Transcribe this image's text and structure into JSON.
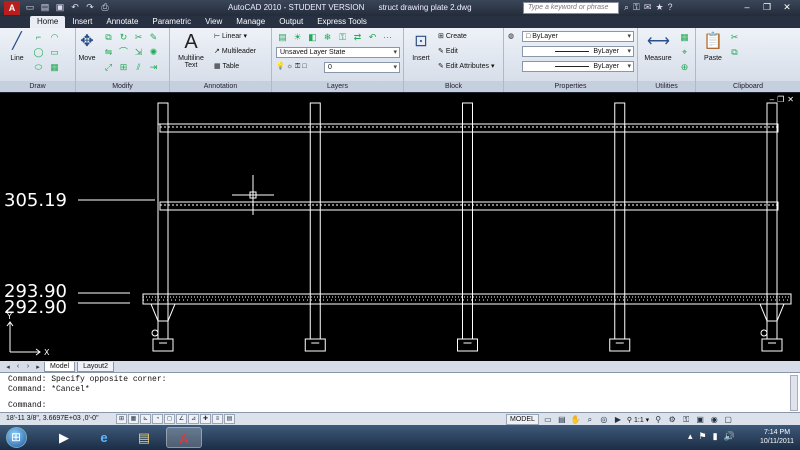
{
  "titlebar": {
    "app_name": "AutoCAD 2010 - STUDENT VERSION",
    "file_name": "struct drawing plate 2.dwg",
    "search_placeholder": "Type a keyword or phrase"
  },
  "ribbon_tabs": [
    "Home",
    "Insert",
    "Annotate",
    "Parametric",
    "View",
    "Manage",
    "Output",
    "Express Tools"
  ],
  "active_tab": "Home",
  "panels": {
    "draw": {
      "title": "Draw",
      "line_label": "Line"
    },
    "modify": {
      "title": "Modify",
      "move_label": "Move"
    },
    "annotation": {
      "title": "Annotation",
      "multiline_label_1": "Multiline",
      "multiline_label_2": "Text",
      "linear_label": "Linear",
      "multileader_label": "Multileader",
      "table_label": "Table"
    },
    "layers": {
      "title": "Layers",
      "layer_state": "Unsaved Layer State",
      "current_layer": "0"
    },
    "block": {
      "title": "Block",
      "insert_label": "Insert",
      "create_label": "Create",
      "edit_label": "Edit",
      "edit_attributes_label": "Edit Attributes"
    },
    "properties": {
      "title": "Properties",
      "color": "ByLayer",
      "linetype": "ByLayer",
      "lineweight": "ByLayer"
    },
    "utilities": {
      "title": "Utilities",
      "measure_label": "Measure"
    },
    "clipboard": {
      "title": "Clipboard",
      "paste_label": "Paste"
    }
  },
  "drawing": {
    "elevation_labels": [
      "305.19",
      "293.90",
      "292.90"
    ],
    "ucs_x": "X",
    "ucs_y": "Y",
    "column_count": 5
  },
  "layout_tabs": [
    "Model",
    "Layout2"
  ],
  "active_layout_tab": "Model",
  "command_line": {
    "history": [
      "Command: Specify opposite corner:",
      "Command: *Cancel*"
    ],
    "prompt": "Command:"
  },
  "status_bar": {
    "coordinates": "18'-11 3/8\",  3.6697E+03 ,0'-0\"",
    "space": "MODEL",
    "scale": "1:1"
  },
  "taskbar": {
    "time": "7:14 PM",
    "date": "10/11/2011"
  }
}
